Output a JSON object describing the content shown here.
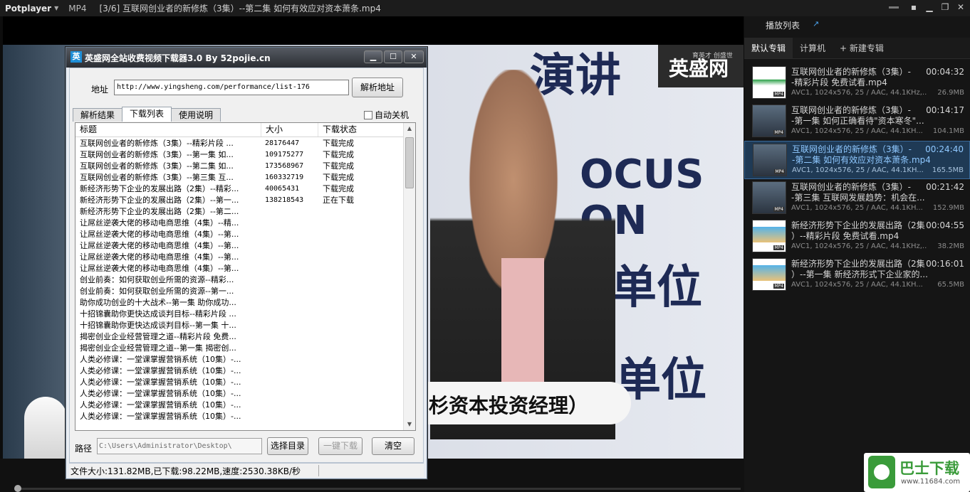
{
  "player": {
    "brand": "Potplayer",
    "format": "MP4",
    "title": "[3/6] 互联网创业者的新修炼（3集）--第二集 如何有效应对资本萧条.mp4"
  },
  "video": {
    "banner_text": "演讲",
    "logo": "英盛网",
    "logo_sub": "育英才 创盛世",
    "focus_text": "OCUS ON",
    "unit_text_1": "办单位",
    "unit_text_2": "单位",
    "caption": "杉资本投资经理）"
  },
  "playlist": {
    "header": "播放列表",
    "tabs": [
      "默认专辑",
      "计算机",
      "+ 新建专辑"
    ],
    "items": [
      {
        "line1": "互联网创业者的新修炼（3集）-",
        "line2": "-精彩片段 免费试看.mp4",
        "duration": "00:04:32",
        "meta": "AVC1, 1024x576, 25 / AAC, 44.1KHz,...",
        "size": "26.9MB",
        "thumb": "white",
        "badge": "MP4"
      },
      {
        "line1": "互联网创业者的新修炼（3集）-",
        "line2": "-第一集 如何正确看待\"资本寒冬\"...",
        "duration": "00:14:17",
        "meta": "AVC1, 1024x576, 25 / AAC, 44.1KH...",
        "size": "104.1MB",
        "thumb": "dark",
        "badge": "MP4"
      },
      {
        "line1": "互联网创业者的新修炼（3集）-",
        "line2": "-第二集 如何有效应对资本萧条.mp4",
        "duration": "00:24:40",
        "meta": "AVC1, 1024x576, 25 / AAC, 44.1KH...",
        "size": "165.5MB",
        "thumb": "dark",
        "badge": "MP4"
      },
      {
        "line1": "互联网创业者的新修炼（3集）-",
        "line2": "-第三集 互联网发展趋势：机会在...",
        "duration": "00:21:42",
        "meta": "AVC1, 1024x576, 25 / AAC, 44.1KH...",
        "size": "152.9MB",
        "thumb": "dark",
        "badge": "MP4"
      },
      {
        "line1": "新经济形势下企业的发展出路（2集",
        "line2": "）--精彩片段 免费试看.mp4",
        "duration": "00:04:55",
        "meta": "AVC1, 1024x576, 25 / AAC, 44.1KHz,...",
        "size": "38.2MB",
        "thumb": "beach",
        "badge": "MP4"
      },
      {
        "line1": "新经济形势下企业的发展出路（2集",
        "line2": "）--第一集 新经济形式下企业家的...",
        "duration": "00:16:01",
        "meta": "AVC1, 1024x576, 25 / AAC, 44.1KH...",
        "size": "65.5MB",
        "thumb": "beach",
        "badge": "MP4"
      }
    ]
  },
  "dialog": {
    "title": "英盛网全站收费视频下载器3.0 By 52pojie.cn",
    "app_icon": "英",
    "addr_label": "地址",
    "addr_value": "http://www.yingsheng.com/performance/list-176",
    "parse_button": "解析地址",
    "tabs": [
      "解析结果",
      "下载列表",
      "使用说明"
    ],
    "auto_shutdown": "自动关机",
    "columns": [
      "标题",
      "大小",
      "下载状态"
    ],
    "rows": [
      [
        "互联网创业者的新修炼（3集）--精彩片段 ...",
        "28176447",
        "下载完成"
      ],
      [
        "互联网创业者的新修炼（3集）--第一集 如...",
        "109175277",
        "下载完成"
      ],
      [
        "互联网创业者的新修炼（3集）--第二集 如...",
        "173568967",
        "下载完成"
      ],
      [
        "互联网创业者的新修炼（3集）--第三集 互...",
        "160332719",
        "下载完成"
      ],
      [
        "新经济形势下企业的发展出路（2集）--精彩...",
        "40065431",
        "下载完成"
      ],
      [
        "新经济形势下企业的发展出路（2集）--第一...",
        "138218543",
        "正在下载"
      ],
      [
        "新经济形势下企业的发展出路（2集）--第二...",
        "",
        ""
      ],
      [
        "让屌丝逆袭大佬的移动电商思维（4集）--精...",
        "",
        ""
      ],
      [
        "让屌丝逆袭大佬的移动电商思维（4集）--第...",
        "",
        ""
      ],
      [
        "让屌丝逆袭大佬的移动电商思维（4集）--第...",
        "",
        ""
      ],
      [
        "让屌丝逆袭大佬的移动电商思维（4集）--第...",
        "",
        ""
      ],
      [
        "让屌丝逆袭大佬的移动电商思维（4集）--第...",
        "",
        ""
      ],
      [
        "创业前奏：如何获取创业所需的资源--精彩...",
        "",
        ""
      ],
      [
        "创业前奏：如何获取创业所需的资源--第一...",
        "",
        ""
      ],
      [
        "助你成功创业的十大战术--第一集 助你成功...",
        "",
        ""
      ],
      [
        "十招锦囊助你更快达成谈判目标--精彩片段 ...",
        "",
        ""
      ],
      [
        "十招锦囊助你更快达成谈判目标--第一集 十...",
        "",
        ""
      ],
      [
        "揭密创业企业经营管理之道--精彩片段 免费...",
        "",
        ""
      ],
      [
        "揭密创业企业经营管理之道--第一集 揭密创...",
        "",
        ""
      ],
      [
        "人类必修课：一堂课掌握营销系统（10集）-...",
        "",
        ""
      ],
      [
        "人类必修课：一堂课掌握营销系统（10集）-...",
        "",
        ""
      ],
      [
        "人类必修课：一堂课掌握营销系统（10集）-...",
        "",
        ""
      ],
      [
        "人类必修课：一堂课掌握营销系统（10集）-...",
        "",
        ""
      ],
      [
        "人类必修课：一堂课掌握营销系统（10集）-...",
        "",
        ""
      ],
      [
        "人类必修课：一堂课掌握营销系统（10集）-...",
        "",
        ""
      ]
    ],
    "path_label": "路径",
    "path_value": "C:\\Users\\Administrator\\Desktop\\",
    "choose_dir_button": "选择目录",
    "one_click_download_button": "一键下载",
    "clear_button": "清空",
    "status": "文件大小:131.82MB,已下载:98.22MB,速度:2530.38KB/秒"
  },
  "watermark": {
    "text": "巴士下载",
    "url": "www.11684.com"
  }
}
